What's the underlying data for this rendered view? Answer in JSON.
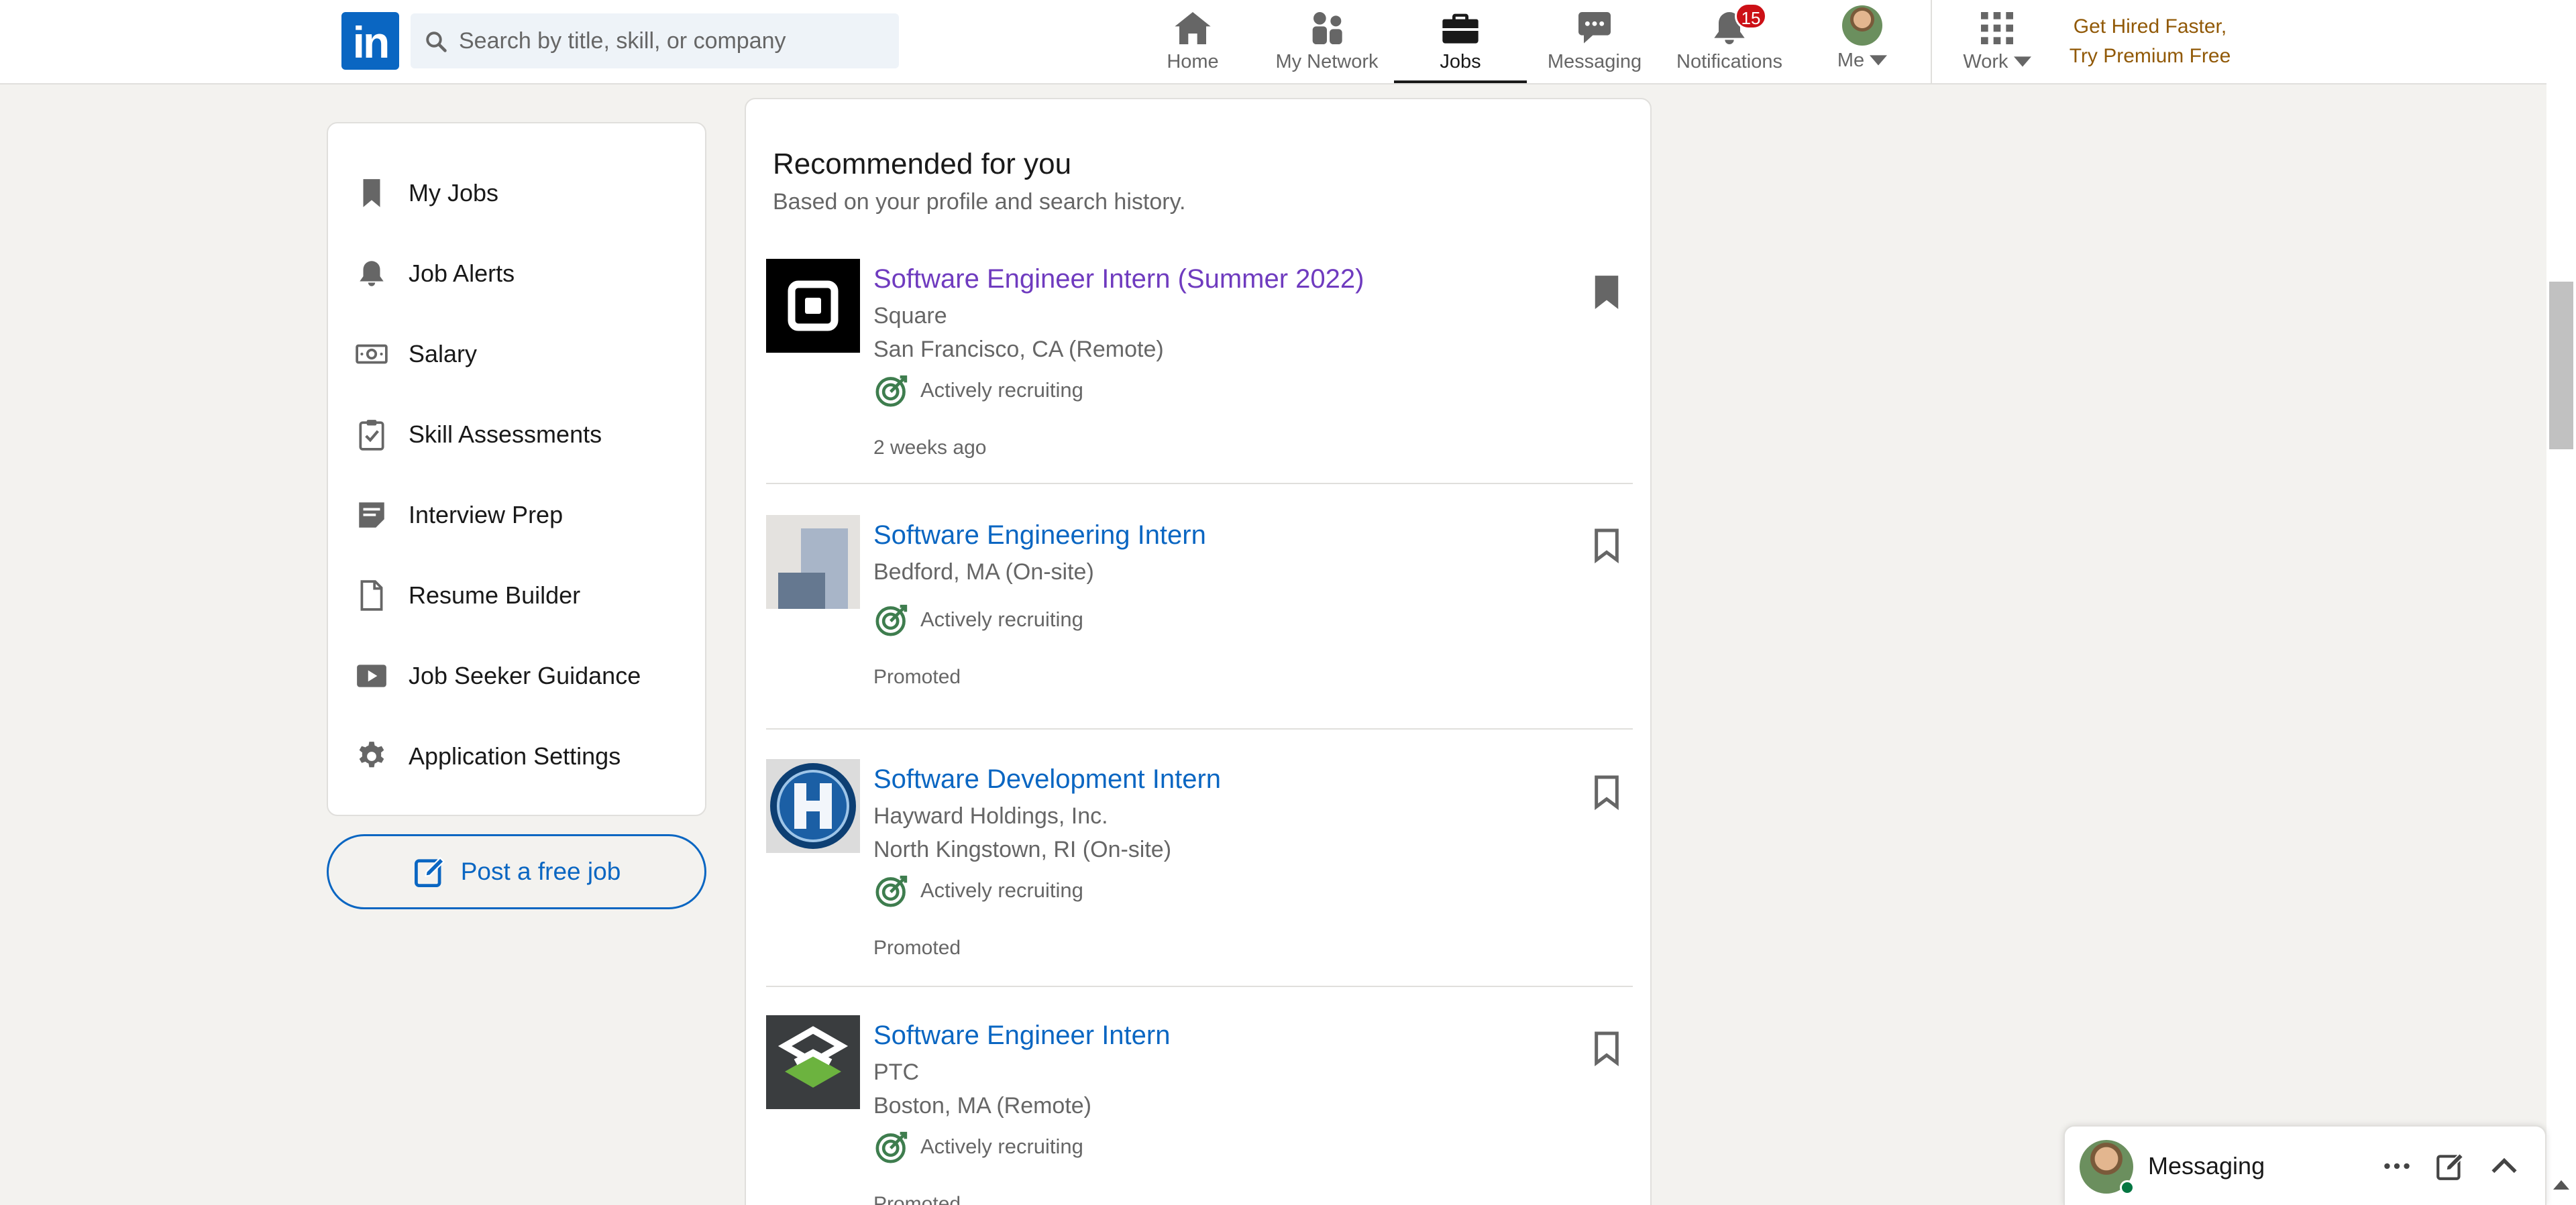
{
  "nav": {
    "logo_text": "in",
    "search_placeholder": "Search by title, skill, or company",
    "items": [
      {
        "label": "Home",
        "icon": "home-icon"
      },
      {
        "label": "My Network",
        "icon": "network-icon"
      },
      {
        "label": "Jobs",
        "icon": "briefcase-icon",
        "active": true
      },
      {
        "label": "Messaging",
        "icon": "chat-icon"
      },
      {
        "label": "Notifications",
        "icon": "bell-icon",
        "badge": "15"
      },
      {
        "label": "Me",
        "icon": "avatar"
      },
      {
        "label": "Work",
        "icon": "grid-icon"
      }
    ],
    "premium_line1": "Get Hired Faster,",
    "premium_line2": "Try Premium Free",
    "colors": {
      "brand": "#0a66c2",
      "badge": "#cc1016",
      "premium": "#915907"
    }
  },
  "sidebar": {
    "items": [
      {
        "label": "My Jobs",
        "icon": "bookmark-icon"
      },
      {
        "label": "Job Alerts",
        "icon": "bell-icon"
      },
      {
        "label": "Salary",
        "icon": "money-icon"
      },
      {
        "label": "Skill Assessments",
        "icon": "clipboard-check-icon"
      },
      {
        "label": "Interview Prep",
        "icon": "notes-icon"
      },
      {
        "label": "Resume Builder",
        "icon": "document-icon"
      },
      {
        "label": "Job Seeker Guidance",
        "icon": "video-icon"
      },
      {
        "label": "Application Settings",
        "icon": "gear-icon"
      }
    ],
    "post_job_label": "Post a free job"
  },
  "main": {
    "title": "Recommended for you",
    "subtitle": "Based on your profile and search history.",
    "jobs": [
      {
        "title": "Software Engineer Intern (Summer 2022)",
        "company": "Square",
        "location": "San Francisco, CA (Remote)",
        "status": "Actively recruiting",
        "meta": "2 weeks ago",
        "logo": "square-logo"
      },
      {
        "title": "Software Engineering Intern",
        "location": "Bedford, MA (On-site)",
        "status": "Actively recruiting",
        "meta": "Promoted",
        "logo": "bars-logo"
      },
      {
        "title": "Software Development Intern",
        "company": "Hayward Holdings, Inc.",
        "location": "North Kingstown, RI (On-site)",
        "status": "Actively recruiting",
        "meta": "Promoted",
        "logo": "hayward-logo"
      },
      {
        "title": "Software Engineer Intern",
        "company": "PTC",
        "location": "Boston, MA (Remote)",
        "status": "Actively recruiting",
        "meta": "Promoted",
        "logo": "ptc-logo"
      }
    ]
  },
  "messaging": {
    "label": "Messaging"
  }
}
